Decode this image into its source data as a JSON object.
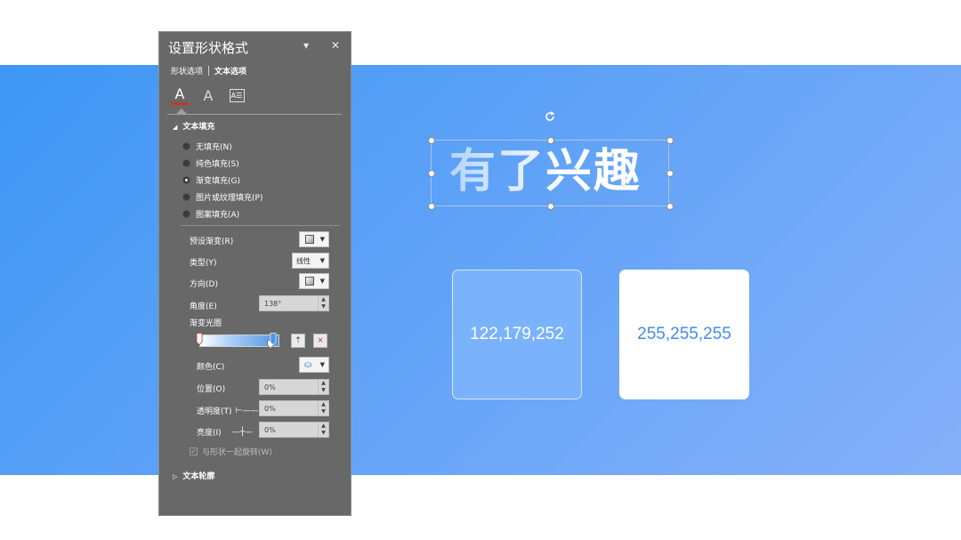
{
  "slide": {
    "headline": "有了兴趣",
    "swatch1": "122,179,252",
    "swatch2": "255,255,255",
    "colors": {
      "band_start": "#3d97f5",
      "band_end": "#86b0f9",
      "swatch1": "#7ab3fc",
      "swatch2": "#ffffff",
      "swatch2_text": "#3f8ee8"
    }
  },
  "pane": {
    "title": "设置形状格式",
    "collapse_glyph": "▾",
    "close_glyph": "✕",
    "tabs": [
      "形状选项",
      "文本选项"
    ],
    "icon_a": "A",
    "icon_box": "A☰",
    "sections": {
      "fill": "文本填充",
      "outline": "文本轮廓"
    },
    "fill_options": [
      "无填充(N)",
      "纯色填充(S)",
      "渐变填充(G)",
      "图片或纹理填充(P)",
      "图案填充(A)"
    ],
    "selected_fill_index": 2,
    "preset_label": "预设渐变(R)",
    "type_label": "类型(Y)",
    "type_value": "线性",
    "direction_label": "方向(D)",
    "angle_label": "角度(E)",
    "angle_value": "138°",
    "stops_label": "渐变光圈",
    "color_label": "颜色(C)",
    "position_label": "位置(O)",
    "position_value": "0%",
    "transparency_label": "透明度(T)",
    "transparency_value": "0%",
    "brightness_label": "亮度(I)",
    "brightness_value": "0%",
    "rotate_label": "与形状一起旋转(W)",
    "rotate_checked": true
  }
}
